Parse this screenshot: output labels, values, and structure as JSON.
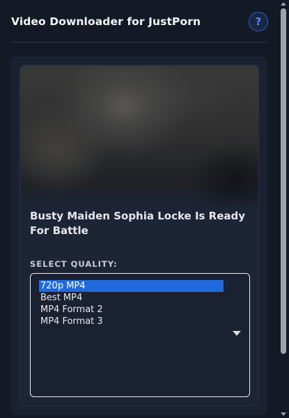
{
  "header": {
    "title": "Video Downloader for JustPorn",
    "help_label": "?"
  },
  "video": {
    "title": "Busty Maiden Sophia Locke Is Ready For Battle"
  },
  "quality": {
    "label": "SELECT QUALITY:",
    "options": [
      "720p MP4",
      "Best MP4",
      "MP4 Format 2",
      "MP4 Format 3"
    ],
    "selected_index": 0
  },
  "colors": {
    "accent": "#1f6bdd",
    "help_ring": "#2f5fd0",
    "background": "#141a25"
  },
  "icons": {
    "help": "help-icon",
    "dropdown": "chevron-down-icon"
  }
}
